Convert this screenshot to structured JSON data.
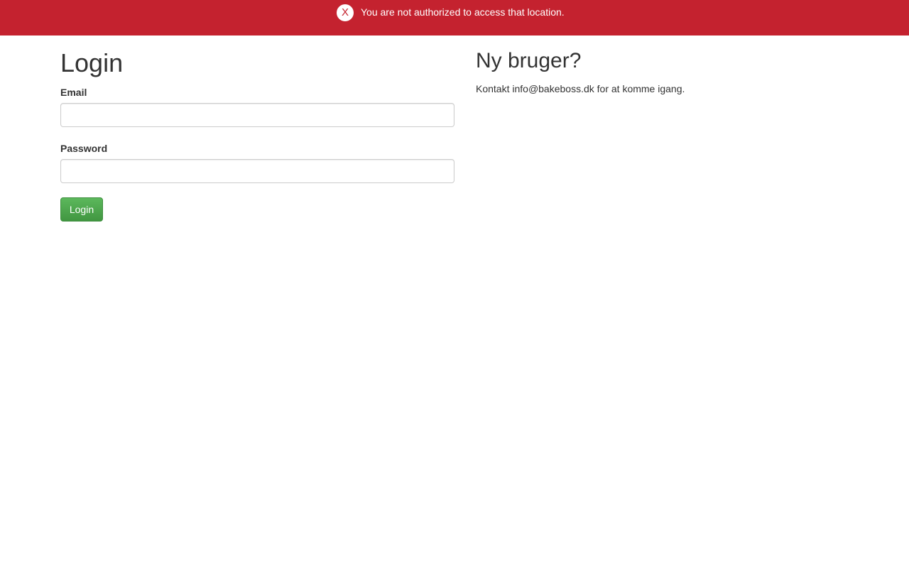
{
  "alert": {
    "close_label": "X",
    "message": "You are not authorized to access that location.",
    "background_color": "#c4222f"
  },
  "login": {
    "title": "Login",
    "email_label": "Email",
    "email_value": "",
    "password_label": "Password",
    "password_value": "",
    "button_label": "Login",
    "button_color": "#5cb85c"
  },
  "new_user": {
    "title": "Ny bruger?",
    "text": "Kontakt info@bakeboss.dk for at komme igang."
  }
}
